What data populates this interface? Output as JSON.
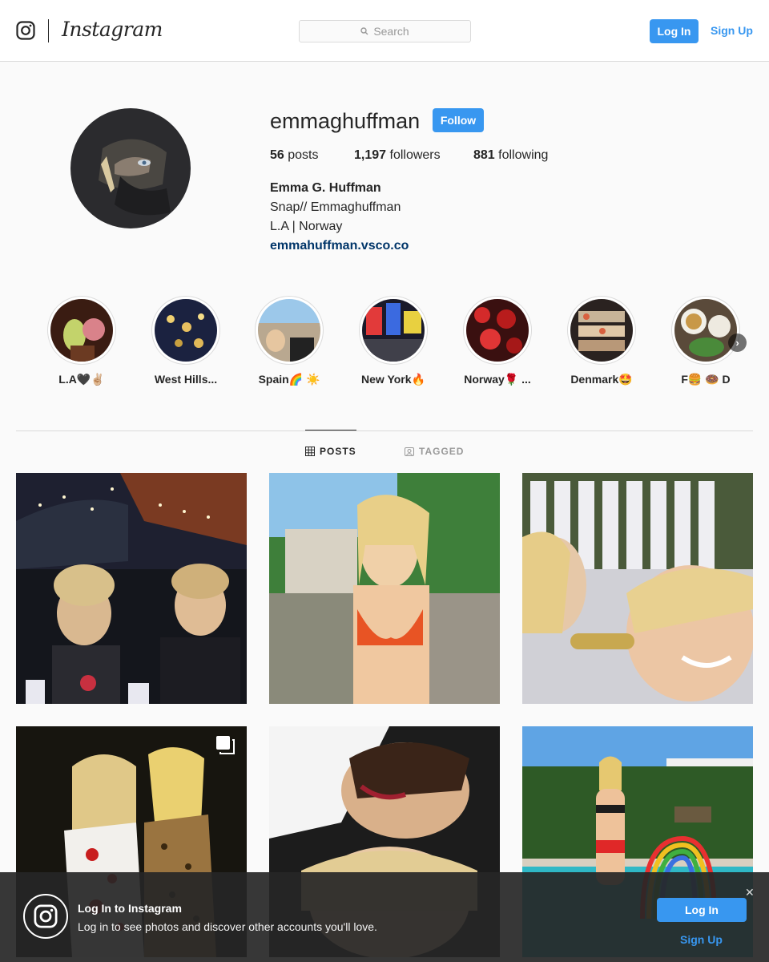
{
  "header": {
    "brand": "Instagram",
    "search_placeholder": "Search",
    "login_label": "Log In",
    "signup_label": "Sign Up"
  },
  "profile": {
    "username": "emmaghuffman",
    "follow_label": "Follow",
    "posts_count": "56",
    "posts_label": "posts",
    "followers_count": "1,197",
    "followers_label": "followers",
    "following_count": "881",
    "following_label": "following",
    "full_name": "Emma G. Huffman",
    "bio_line1": "Snap// Emmaghuffman",
    "bio_line2": "L.A | Norway",
    "website": "emmahuffman.vsco.co"
  },
  "highlights": [
    {
      "label": "L.A🖤✌🏼"
    },
    {
      "label": "West Hills..."
    },
    {
      "label": "Spain🌈 ☀️"
    },
    {
      "label": "New York🔥"
    },
    {
      "label": "Norway🌹 ..."
    },
    {
      "label": "Denmark🤩"
    },
    {
      "label": "F🍔 🍩 D"
    }
  ],
  "tabs": {
    "posts": "POSTS",
    "tagged": "TAGGED"
  },
  "banner": {
    "title": "Log In to Instagram",
    "text": "Log in to see photos and discover other accounts you'll love.",
    "login_label": "Log In",
    "signup_label": "Sign Up",
    "close_glyph": "✕"
  },
  "colors": {
    "accent": "#3897f0",
    "link": "#003569",
    "text": "#262626",
    "border": "#dbdbdb"
  }
}
